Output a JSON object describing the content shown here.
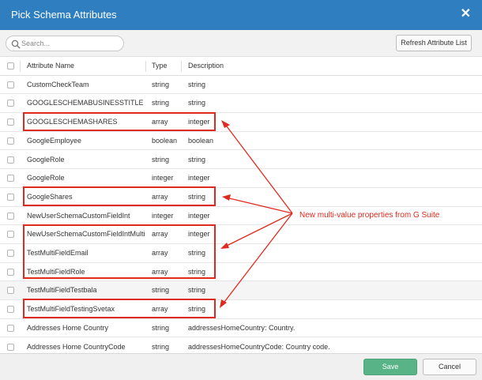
{
  "dialog": {
    "title": "Pick Schema Attributes",
    "close_glyph": "✕"
  },
  "search": {
    "placeholder": "Search...",
    "value": ""
  },
  "toolbar": {
    "refresh_label": "Refresh Attribute List"
  },
  "table": {
    "headers": {
      "name": "Attribute Name",
      "type": "Type",
      "description": "Description"
    },
    "rows": [
      {
        "name": "CustomCheckTeam",
        "type": "string",
        "description": "string",
        "highlighted": false
      },
      {
        "name": "GOOGLESCHEMABUSINESSTITLE",
        "type": "string",
        "description": "string",
        "highlighted": false
      },
      {
        "name": "GOOGLESCHEMASHARES",
        "type": "array",
        "description": "integer",
        "highlighted": true
      },
      {
        "name": "GoogleEmployee",
        "type": "boolean",
        "description": "boolean",
        "highlighted": false
      },
      {
        "name": "GoogleRole",
        "type": "string",
        "description": "string",
        "highlighted": false
      },
      {
        "name": "GoogleRole",
        "type": "integer",
        "description": "integer",
        "highlighted": false
      },
      {
        "name": "GoogleShares",
        "type": "array",
        "description": "string",
        "highlighted": true
      },
      {
        "name": "NewUserSchemaCustomFieldInt",
        "type": "integer",
        "description": "integer",
        "highlighted": false
      },
      {
        "name": "NewUserSchemaCustomFieldIntMulti",
        "type": "array",
        "description": "integer",
        "highlighted": true
      },
      {
        "name": "TestMultiFieldEmail",
        "type": "array",
        "description": "string",
        "highlighted": true
      },
      {
        "name": "TestMultiFieldRole",
        "type": "array",
        "description": "string",
        "highlighted": true
      },
      {
        "name": "TestMultiFieldTestbala",
        "type": "string",
        "description": "string",
        "highlighted": false,
        "alt": true
      },
      {
        "name": "TestMultiFieldTestingSvetax",
        "type": "array",
        "description": "string",
        "highlighted": true
      },
      {
        "name": "Addresses Home Country",
        "type": "string",
        "description": "addressesHomeCountry: Country.",
        "highlighted": false
      },
      {
        "name": "Addresses Home CountryCode",
        "type": "string",
        "description": "addressesHomeCountryCode: Country code.",
        "highlighted": false
      }
    ]
  },
  "annotation": {
    "text": "New multi-value properties from G Suite",
    "color": "#e02a1f"
  },
  "footer": {
    "save_label": "Save",
    "cancel_label": "Cancel"
  },
  "colors": {
    "titlebar": "#2f7fc0",
    "save": "#58b386",
    "highlight": "#e02a1f"
  },
  "icons": {
    "search": "search-icon",
    "close": "close-icon"
  }
}
